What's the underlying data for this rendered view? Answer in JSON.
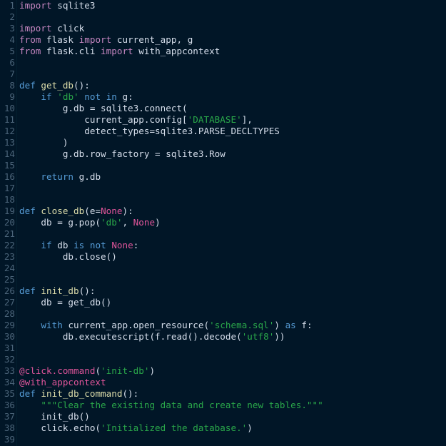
{
  "editor": {
    "language": "python",
    "theme_name": "dark-navy",
    "colors": {
      "background": "#011627",
      "gutter_text": "#4b6479",
      "gutter_rule": "#03202f",
      "default_text": "#d6deeb",
      "keyword": "#569cd6",
      "import_keyword": "#c586c0",
      "function_name": "#dcdcaa",
      "string": "#2aa84a",
      "docstring": "#2aa84a",
      "decorator": "#e0559a",
      "none_literal": "#e0559a"
    },
    "first_line": 1,
    "last_line": 39,
    "line_count": 39
  },
  "lines": [
    {
      "n": "1",
      "tokens": [
        {
          "t": "import",
          "c": "imp"
        },
        {
          "t": " sqlite3",
          "c": "id"
        }
      ]
    },
    {
      "n": "2",
      "tokens": []
    },
    {
      "n": "3",
      "tokens": [
        {
          "t": "import",
          "c": "imp"
        },
        {
          "t": " click",
          "c": "id"
        }
      ]
    },
    {
      "n": "4",
      "tokens": [
        {
          "t": "from",
          "c": "imp"
        },
        {
          "t": " flask ",
          "c": "id"
        },
        {
          "t": "import",
          "c": "imp"
        },
        {
          "t": " current_app, g",
          "c": "id"
        }
      ]
    },
    {
      "n": "5",
      "tokens": [
        {
          "t": "from",
          "c": "imp"
        },
        {
          "t": " flask.cli ",
          "c": "id"
        },
        {
          "t": "import",
          "c": "imp"
        },
        {
          "t": " with_appcontext",
          "c": "id"
        }
      ]
    },
    {
      "n": "6",
      "tokens": []
    },
    {
      "n": "7",
      "tokens": []
    },
    {
      "n": "8",
      "tokens": [
        {
          "t": "def",
          "c": "kw"
        },
        {
          "t": " ",
          "c": "id"
        },
        {
          "t": "get_db",
          "c": "fn"
        },
        {
          "t": "():",
          "c": "id"
        }
      ]
    },
    {
      "n": "9",
      "tokens": [
        {
          "t": "    ",
          "c": "id"
        },
        {
          "t": "if",
          "c": "kw"
        },
        {
          "t": " ",
          "c": "id"
        },
        {
          "t": "'db'",
          "c": "str"
        },
        {
          "t": " ",
          "c": "id"
        },
        {
          "t": "not",
          "c": "kw"
        },
        {
          "t": " ",
          "c": "id"
        },
        {
          "t": "in",
          "c": "kw"
        },
        {
          "t": " g:",
          "c": "id"
        }
      ]
    },
    {
      "n": "10",
      "tokens": [
        {
          "t": "        g.db = sqlite3.connect(",
          "c": "id"
        }
      ]
    },
    {
      "n": "11",
      "tokens": [
        {
          "t": "            current_app.config[",
          "c": "id"
        },
        {
          "t": "'DATABASE'",
          "c": "str"
        },
        {
          "t": "],",
          "c": "id"
        }
      ]
    },
    {
      "n": "12",
      "tokens": [
        {
          "t": "            detect_types=sqlite3.PARSE_DECLTYPES",
          "c": "id"
        }
      ]
    },
    {
      "n": "13",
      "tokens": [
        {
          "t": "        )",
          "c": "id"
        }
      ]
    },
    {
      "n": "14",
      "tokens": [
        {
          "t": "        g.db.row_factory = sqlite3.Row",
          "c": "id"
        }
      ]
    },
    {
      "n": "15",
      "tokens": []
    },
    {
      "n": "16",
      "tokens": [
        {
          "t": "    ",
          "c": "id"
        },
        {
          "t": "return",
          "c": "kw"
        },
        {
          "t": " g.db",
          "c": "id"
        }
      ]
    },
    {
      "n": "17",
      "tokens": []
    },
    {
      "n": "18",
      "tokens": []
    },
    {
      "n": "19",
      "tokens": [
        {
          "t": "def",
          "c": "kw"
        },
        {
          "t": " ",
          "c": "id"
        },
        {
          "t": "close_db",
          "c": "fn"
        },
        {
          "t": "(e=",
          "c": "id"
        },
        {
          "t": "None",
          "c": "none"
        },
        {
          "t": "):",
          "c": "id"
        }
      ]
    },
    {
      "n": "20",
      "tokens": [
        {
          "t": "    db = g.pop(",
          "c": "id"
        },
        {
          "t": "'db'",
          "c": "str"
        },
        {
          "t": ", ",
          "c": "id"
        },
        {
          "t": "None",
          "c": "none"
        },
        {
          "t": ")",
          "c": "id"
        }
      ]
    },
    {
      "n": "21",
      "tokens": []
    },
    {
      "n": "22",
      "tokens": [
        {
          "t": "    ",
          "c": "id"
        },
        {
          "t": "if",
          "c": "kw"
        },
        {
          "t": " db ",
          "c": "id"
        },
        {
          "t": "is",
          "c": "kw"
        },
        {
          "t": " ",
          "c": "id"
        },
        {
          "t": "not",
          "c": "kw"
        },
        {
          "t": " ",
          "c": "id"
        },
        {
          "t": "None",
          "c": "none"
        },
        {
          "t": ":",
          "c": "id"
        }
      ]
    },
    {
      "n": "23",
      "tokens": [
        {
          "t": "        db.close()",
          "c": "id"
        }
      ]
    },
    {
      "n": "24",
      "tokens": []
    },
    {
      "n": "25",
      "tokens": []
    },
    {
      "n": "26",
      "tokens": [
        {
          "t": "def",
          "c": "kw"
        },
        {
          "t": " ",
          "c": "id"
        },
        {
          "t": "init_db",
          "c": "fn"
        },
        {
          "t": "():",
          "c": "id"
        }
      ]
    },
    {
      "n": "27",
      "tokens": [
        {
          "t": "    db = get_db()",
          "c": "id"
        }
      ]
    },
    {
      "n": "28",
      "tokens": []
    },
    {
      "n": "29",
      "tokens": [
        {
          "t": "    ",
          "c": "id"
        },
        {
          "t": "with",
          "c": "kw"
        },
        {
          "t": " current_app.open_resource(",
          "c": "id"
        },
        {
          "t": "'schema.sql'",
          "c": "str"
        },
        {
          "t": ") ",
          "c": "id"
        },
        {
          "t": "as",
          "c": "kw"
        },
        {
          "t": " f:",
          "c": "id"
        }
      ]
    },
    {
      "n": "30",
      "tokens": [
        {
          "t": "        db.executescript(f.read().decode(",
          "c": "id"
        },
        {
          "t": "'utf8'",
          "c": "str"
        },
        {
          "t": "))",
          "c": "id"
        }
      ]
    },
    {
      "n": "31",
      "tokens": []
    },
    {
      "n": "32",
      "tokens": []
    },
    {
      "n": "33",
      "tokens": [
        {
          "t": "@click.command",
          "c": "dec"
        },
        {
          "t": "(",
          "c": "id"
        },
        {
          "t": "'init-db'",
          "c": "str"
        },
        {
          "t": ")",
          "c": "id"
        }
      ]
    },
    {
      "n": "34",
      "tokens": [
        {
          "t": "@with_appcontext",
          "c": "dec"
        }
      ]
    },
    {
      "n": "35",
      "tokens": [
        {
          "t": "def",
          "c": "kw"
        },
        {
          "t": " ",
          "c": "id"
        },
        {
          "t": "init_db_command",
          "c": "fn"
        },
        {
          "t": "():",
          "c": "id"
        }
      ]
    },
    {
      "n": "36",
      "tokens": [
        {
          "t": "    ",
          "c": "id"
        },
        {
          "t": "\"\"\"Clear the existing data and create new tables.\"\"\"",
          "c": "doc"
        }
      ]
    },
    {
      "n": "37",
      "tokens": [
        {
          "t": "    init_db()",
          "c": "id"
        }
      ]
    },
    {
      "n": "38",
      "tokens": [
        {
          "t": "    click.echo(",
          "c": "id"
        },
        {
          "t": "'Initialized the database.'",
          "c": "str"
        },
        {
          "t": ")",
          "c": "id"
        }
      ]
    },
    {
      "n": "39",
      "tokens": []
    }
  ]
}
